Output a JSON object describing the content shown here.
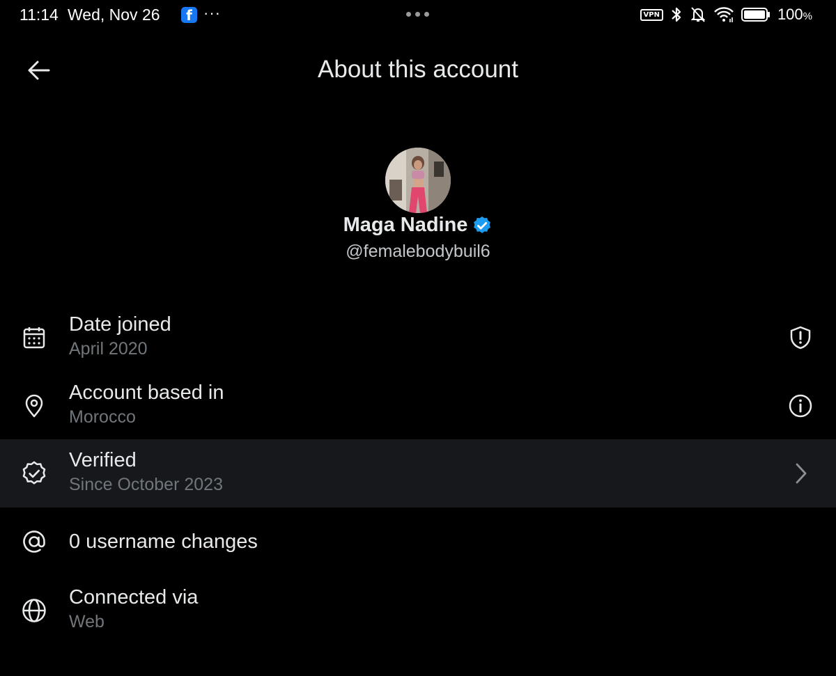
{
  "status_bar": {
    "time": "11:14",
    "date": "Wed, Nov 26",
    "more": "···",
    "vpn": "VPN",
    "battery": "100",
    "battery_unit": "%"
  },
  "header": {
    "title": "About this account"
  },
  "profile": {
    "display_name": "Maga Nadine",
    "handle": "@femalebodybuil6",
    "verified_color": "#1d9bf0"
  },
  "rows": [
    {
      "icon": "calendar-icon",
      "title": "Date joined",
      "subtitle": "April 2020",
      "trailing": "shield-alert-icon"
    },
    {
      "icon": "location-pin-icon",
      "title": "Account based in",
      "subtitle": "Morocco",
      "trailing": "info-icon"
    },
    {
      "icon": "verified-badge-icon",
      "title": "Verified",
      "subtitle": "Since October 2023",
      "trailing": "chevron-right-icon"
    },
    {
      "icon": "at-sign-icon",
      "title": "0 username changes",
      "subtitle": "",
      "trailing": ""
    },
    {
      "icon": "globe-icon",
      "title": "Connected via",
      "subtitle": "Web",
      "trailing": ""
    }
  ],
  "colors": {
    "background": "#000000",
    "text_primary": "#e7e9ea",
    "text_secondary": "#71767b",
    "highlight_row": "#16181c",
    "facebook": "#1877f2"
  }
}
